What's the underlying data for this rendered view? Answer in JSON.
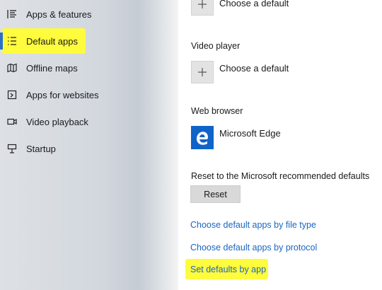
{
  "sidebar": {
    "items": [
      {
        "label": "Apps & features",
        "icon": "apps-features-icon"
      },
      {
        "label": "Default apps",
        "icon": "default-apps-icon",
        "active": true
      },
      {
        "label": "Offline maps",
        "icon": "map-icon"
      },
      {
        "label": "Apps for websites",
        "icon": "apps-websites-icon"
      },
      {
        "label": "Video playback",
        "icon": "video-icon"
      },
      {
        "label": "Startup",
        "icon": "startup-icon"
      }
    ],
    "highlight_color": "#fffb3d",
    "accent_color": "#2a6fc9"
  },
  "main": {
    "top_default": {
      "label": "Choose a default"
    },
    "video_player": {
      "heading": "Video player",
      "label": "Choose a default"
    },
    "web_browser": {
      "heading": "Web browser",
      "app": "Microsoft Edge",
      "icon": "edge-icon"
    },
    "reset": {
      "heading": "Reset to the Microsoft recommended defaults",
      "button": "Reset"
    },
    "links": {
      "by_file_type": "Choose default apps by file type",
      "by_protocol": "Choose default apps by protocol",
      "by_app": "Set defaults by app"
    },
    "link_color": "#1a66c2"
  }
}
